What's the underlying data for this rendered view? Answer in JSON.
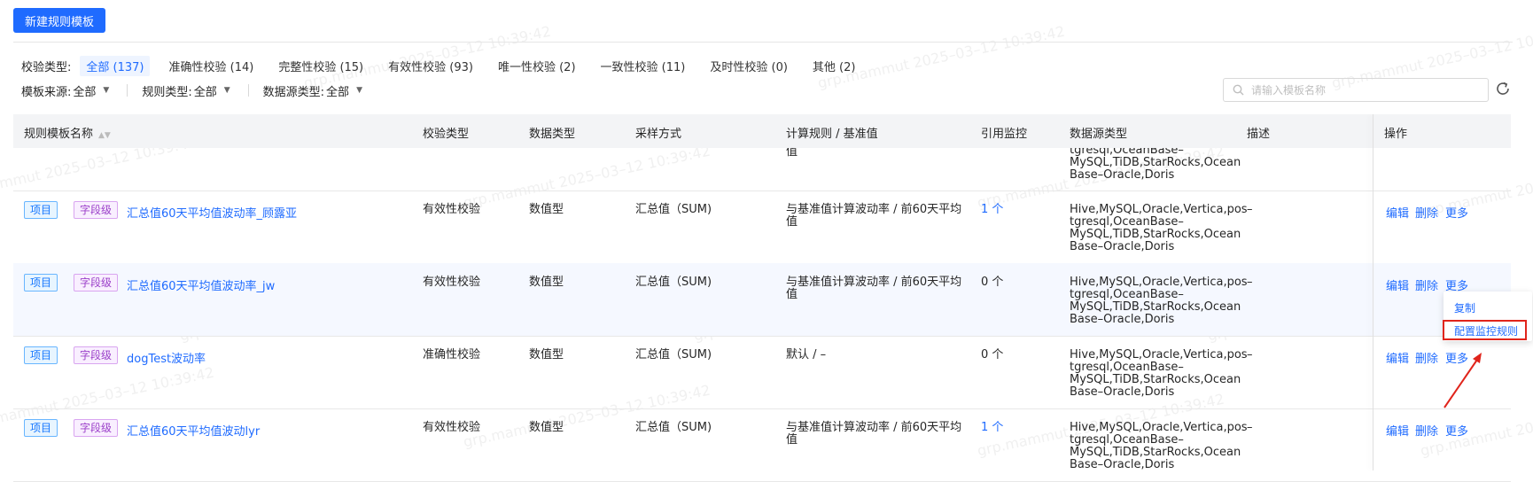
{
  "toolbar": {
    "new_template_button": "新建规则模板"
  },
  "filters": {
    "check_type_label": "校验类型:",
    "tabs": [
      "全部 (137)",
      "准确性校验 (14)",
      "完整性校验 (15)",
      "有效性校验 (93)",
      "唯一性校验 (2)",
      "一致性校验 (11)",
      "及时性校验 (0)",
      "其他 (2)"
    ],
    "active_tab_index": 0,
    "template_source_label": "模板来源:",
    "template_source_value": "全部",
    "rule_type_label": "规则类型:",
    "rule_type_value": "全部",
    "datasource_type_label": "数据源类型:",
    "datasource_type_value": "全部"
  },
  "search": {
    "placeholder": "请输入模板名称",
    "value": ""
  },
  "icons": {
    "search": "search-icon",
    "refresh": "refresh-icon",
    "sort": "sort-icon",
    "dropdown": "caret-down-icon"
  },
  "table": {
    "headers": [
      "规则模板名称",
      "校验类型",
      "数据类型",
      "采样方式",
      "计算规则 / 基准值",
      "引用监控",
      "数据源类型",
      "描述",
      "操作"
    ],
    "partial_row": {
      "calc_rule": "值",
      "datasource": [
        "tgresql,OceanBase–",
        "MySQL,TiDB,StarRocks,Ocean",
        "Base–Oracle,Doris"
      ]
    },
    "rows": [
      {
        "scope_tag": "项目",
        "level_tag": "字段级",
        "name": "汇总值60天平均值波动率_顾露亚",
        "check_type": "有效性校验",
        "data_type": "数值型",
        "sampling": "汇总值（SUM)",
        "calc_rule": [
          "与基准值计算波动率 / 前60天平均",
          "值"
        ],
        "ref_monitor": "1 个",
        "ref_is_link": true,
        "datasource": [
          "Hive,MySQL,Oracle,Vertica,pos",
          "tgresql,OceanBase–",
          "MySQL,TiDB,StarRocks,Ocean",
          "Base–Oracle,Doris"
        ],
        "description": "–",
        "ops": [
          "编辑",
          "删除",
          "更多"
        ]
      },
      {
        "scope_tag": "项目",
        "level_tag": "字段级",
        "name": "汇总值60天平均值波动率_jw",
        "check_type": "有效性校验",
        "data_type": "数值型",
        "sampling": "汇总值（SUM)",
        "calc_rule": [
          "与基准值计算波动率 / 前60天平均",
          "值"
        ],
        "ref_monitor": "0 个",
        "ref_is_link": false,
        "datasource": [
          "Hive,MySQL,Oracle,Vertica,pos",
          "tgresql,OceanBase–",
          "MySQL,TiDB,StarRocks,Ocean",
          "Base–Oracle,Doris"
        ],
        "description": "–",
        "ops": [
          "编辑",
          "删除",
          "更多"
        ]
      },
      {
        "scope_tag": "项目",
        "level_tag": "字段级",
        "name": "dogTest波动率",
        "check_type": "准确性校验",
        "data_type": "数值型",
        "sampling": "汇总值（SUM)",
        "calc_rule": [
          "默认 / –"
        ],
        "ref_monitor": "0 个",
        "ref_is_link": false,
        "datasource": [
          "Hive,MySQL,Oracle,Vertica,pos",
          "tgresql,OceanBase–",
          "MySQL,TiDB,StarRocks,Ocean",
          "Base–Oracle,Doris"
        ],
        "description": "–",
        "ops": [
          "编辑",
          "删除",
          "更多"
        ]
      },
      {
        "scope_tag": "项目",
        "level_tag": "字段级",
        "name": "汇总值60天平均值波动lyr",
        "check_type": "有效性校验",
        "data_type": "数值型",
        "sampling": "汇总值（SUM)",
        "calc_rule": [
          "与基准值计算波动率 / 前60天平均",
          "值"
        ],
        "ref_monitor": "1 个",
        "ref_is_link": true,
        "datasource": [
          "Hive,MySQL,Oracle,Vertica,pos",
          "tgresql,OceanBase–",
          "MySQL,TiDB,StarRocks,Ocean",
          "Base–Oracle,Doris"
        ],
        "description": "–",
        "ops": [
          "编辑",
          "删除",
          "更多"
        ]
      }
    ]
  },
  "more_menu": {
    "items": [
      "复制",
      "配置监控规则"
    ],
    "highlighted_index": 1
  },
  "watermark": {
    "text": "grp.mammut 2025–03–12 10:39:42"
  },
  "colors": {
    "primary": "#1f6bff",
    "highlight_border": "#e0241b",
    "project_tag": "#1677ff",
    "field_tag": "#9b3fc9",
    "arrow": "#e0241b"
  }
}
